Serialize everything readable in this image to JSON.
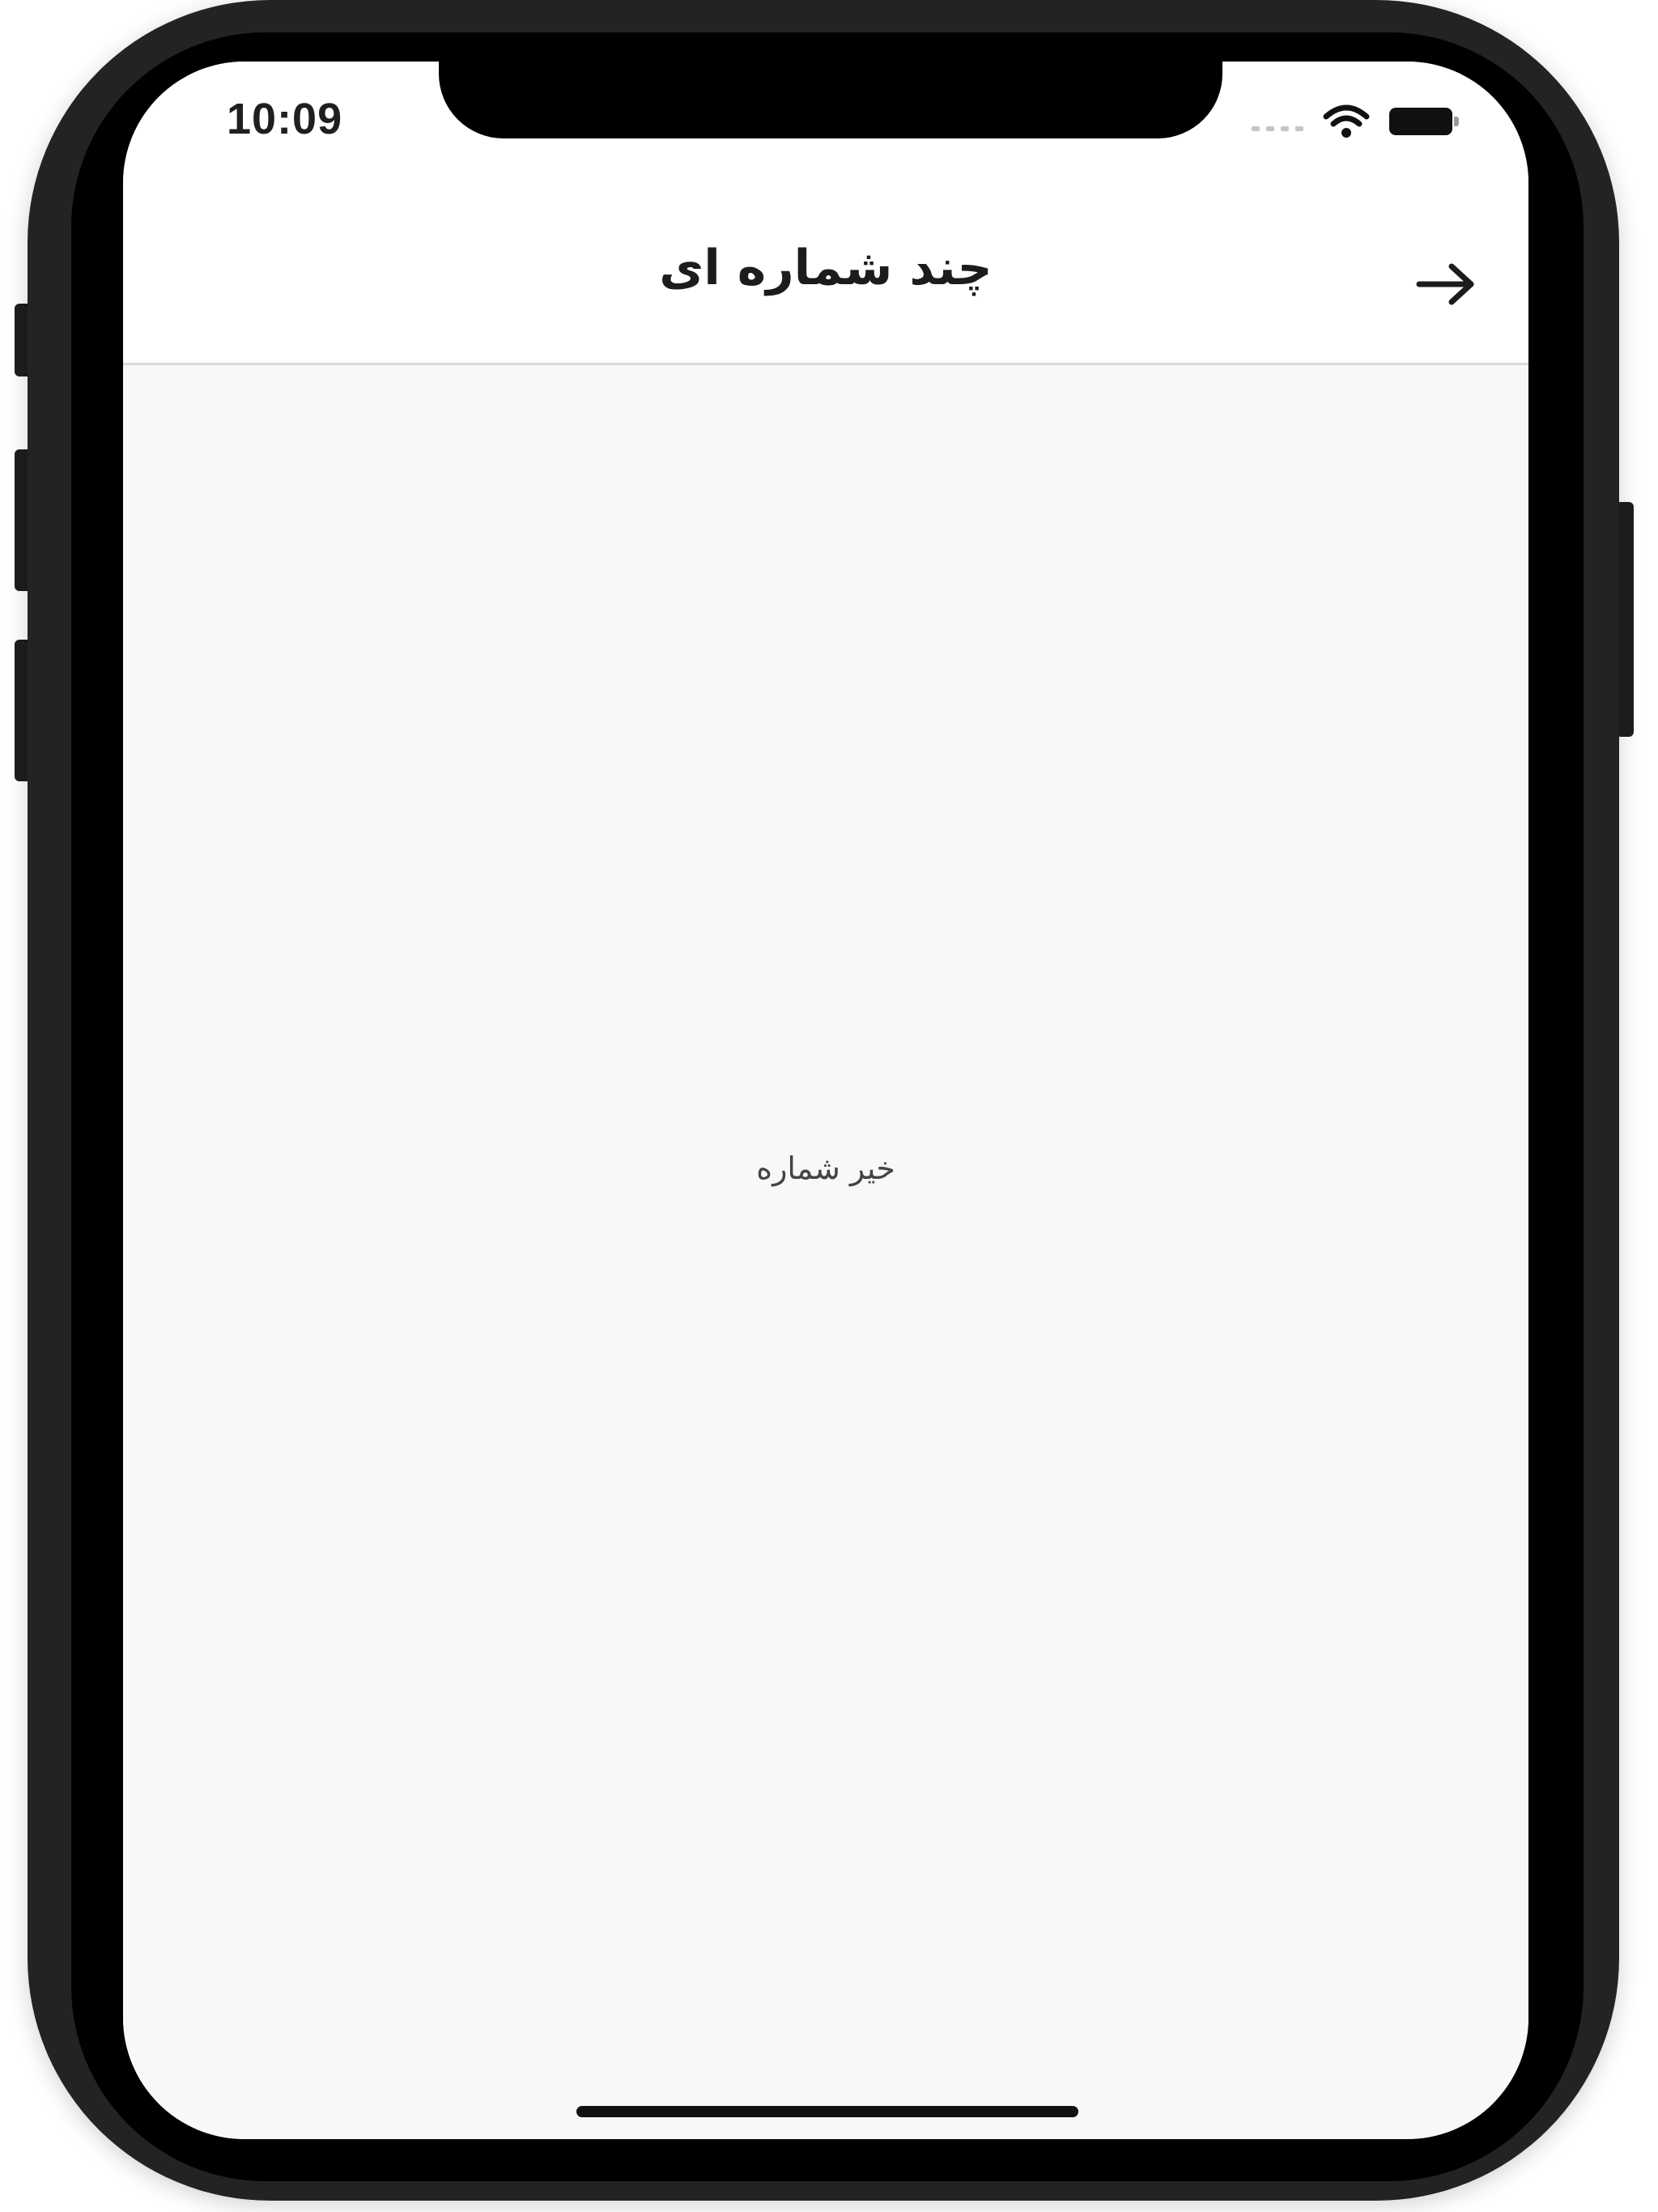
{
  "status_bar": {
    "time": "10:09",
    "wifi_icon": "wifi-icon",
    "battery_icon": "battery-icon",
    "signal_icon": "cellular-signal-icon"
  },
  "nav_bar": {
    "title": "چند شماره ای",
    "back_icon": "arrow-right-icon"
  },
  "content": {
    "empty_message": "خیر شماره"
  },
  "colors": {
    "screen_background": "#f8f8f8",
    "nav_background": "#ffffff",
    "text_primary": "#1c1c1c",
    "divider": "#d9d9d9"
  }
}
